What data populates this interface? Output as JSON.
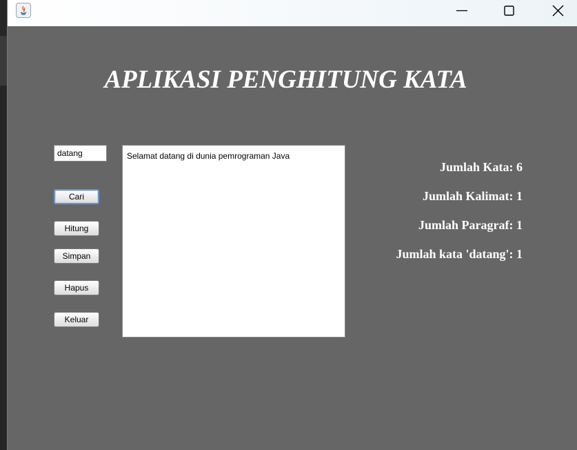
{
  "window": {
    "controls": {
      "minimize": "minimize-icon",
      "maximize": "maximize-icon",
      "close": "close-icon"
    },
    "app_icon": "java-icon"
  },
  "title": "APLIKASI PENGHITUNG KATA",
  "search": {
    "value": "datang"
  },
  "buttons": {
    "cari": "Cari",
    "hitung": "Hitung",
    "simpan": "Simpan",
    "hapus": "Hapus",
    "keluar": "Keluar"
  },
  "text_area": {
    "value": "Selamat datang di dunia pemrograman Java"
  },
  "results": {
    "word_count": "Jumlah Kata: 6",
    "sentence_count": "Jumlah Kalimat: 1",
    "paragraph_count": "Jumlah Paragraf: 1",
    "search_count": "Jumlah kata 'datang': 1"
  },
  "colors": {
    "background": "#666666",
    "text": "#ffffff",
    "focus_border": "#6c94c8"
  }
}
